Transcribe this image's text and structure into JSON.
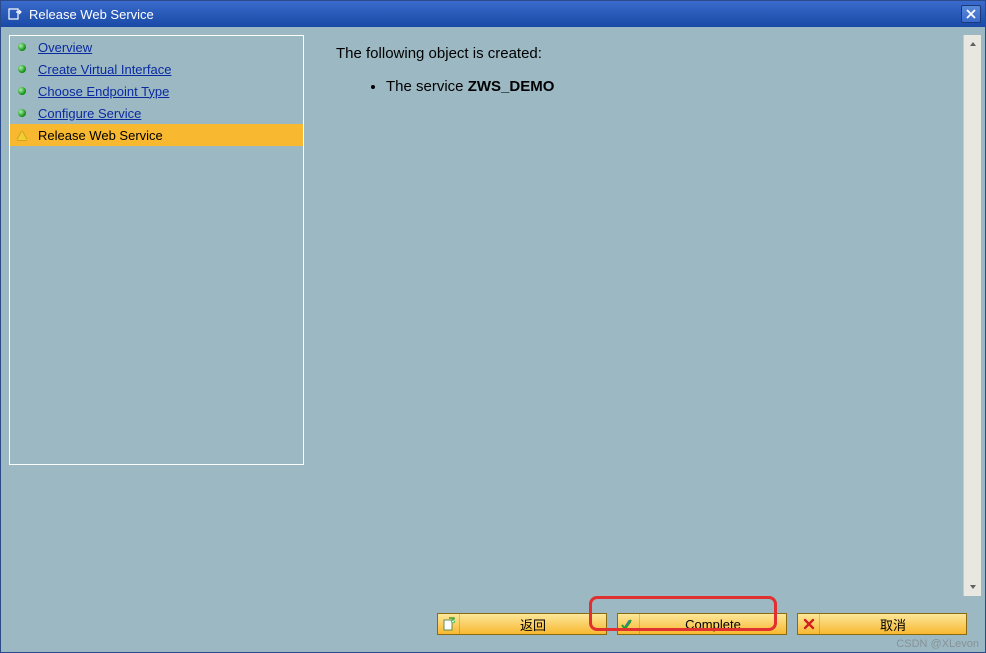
{
  "window": {
    "title": "Release Web Service"
  },
  "sidebar": {
    "items": [
      {
        "label": "Overview",
        "state": "done"
      },
      {
        "label": "Create Virtual Interface",
        "state": "done"
      },
      {
        "label": "Choose Endpoint Type",
        "state": "done"
      },
      {
        "label": "Configure Service",
        "state": "done"
      },
      {
        "label": "Release Web Service",
        "state": "current"
      }
    ]
  },
  "content": {
    "heading": "The following object is created:",
    "item_prefix": "The service ",
    "item_bold": "ZWS_DEMO"
  },
  "buttons": {
    "back": "返回",
    "complete": "Complete",
    "cancel": "取消"
  },
  "watermark": "CSDN @XLevon"
}
